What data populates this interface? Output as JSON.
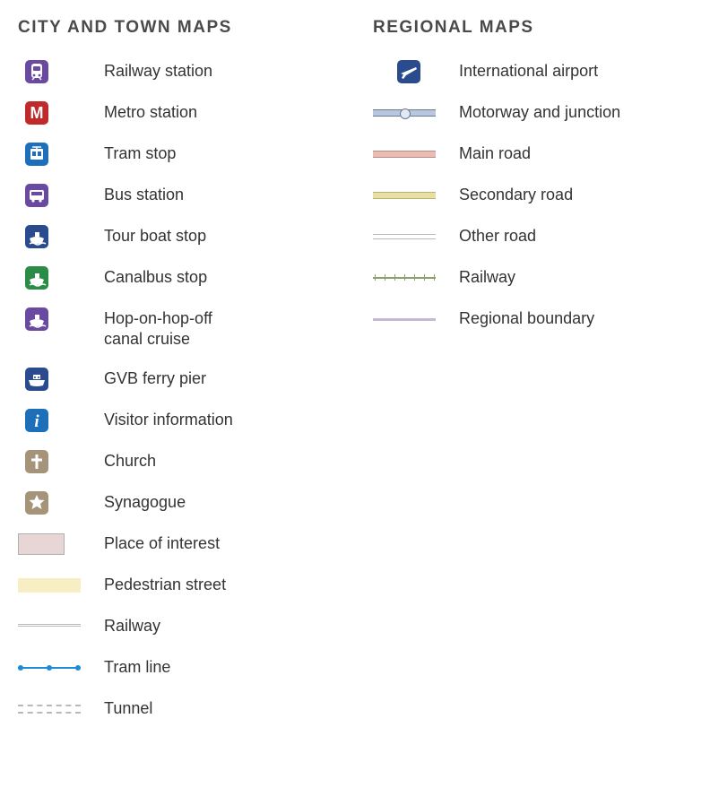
{
  "headings": {
    "city": "CITY AND TOWN MAPS",
    "regional": "REGIONAL MAPS"
  },
  "city_legend": [
    {
      "id": "railway-station",
      "label": "Railway station",
      "symbol": "icon",
      "icon": "train",
      "bg": "purple",
      "pos": "icon"
    },
    {
      "id": "metro-station",
      "label": "Metro station",
      "symbol": "icon",
      "icon": "metro",
      "bg": "red",
      "pos": "icon"
    },
    {
      "id": "tram-stop",
      "label": "Tram stop",
      "symbol": "icon",
      "icon": "tram",
      "bg": "blue",
      "pos": "icon"
    },
    {
      "id": "bus-station",
      "label": "Bus station",
      "symbol": "icon",
      "icon": "bus",
      "bg": "purple",
      "pos": "icon"
    },
    {
      "id": "tour-boat-stop",
      "label": "Tour boat stop",
      "symbol": "icon",
      "icon": "boat",
      "bg": "dblue",
      "pos": "icon"
    },
    {
      "id": "canalbus-stop",
      "label": "Canalbus stop",
      "symbol": "icon",
      "icon": "boat",
      "bg": "green",
      "pos": "icon"
    },
    {
      "id": "hop-on-hop-off",
      "label": "Hop-on-hop-off\ncanal cruise",
      "symbol": "icon",
      "icon": "boat",
      "bg": "purple",
      "pos": "icon"
    },
    {
      "id": "gvb-ferry-pier",
      "label": "GVB ferry pier",
      "symbol": "icon",
      "icon": "ferry",
      "bg": "dblue",
      "pos": "icon"
    },
    {
      "id": "visitor-info",
      "label": "Visitor information",
      "symbol": "icon",
      "icon": "info",
      "bg": "blue",
      "pos": "icon"
    },
    {
      "id": "church",
      "label": "Church",
      "symbol": "icon",
      "icon": "cross",
      "bg": "tan",
      "pos": "icon"
    },
    {
      "id": "synagogue",
      "label": "Synagogue",
      "symbol": "icon",
      "icon": "star",
      "bg": "tan",
      "pos": "icon"
    },
    {
      "id": "place-of-interest",
      "label": "Place of interest",
      "symbol": "block",
      "class": "place-interest",
      "pos": "full"
    },
    {
      "id": "pedestrian-street",
      "label": "Pedestrian street",
      "symbol": "block",
      "class": "ped-street",
      "pos": "full"
    },
    {
      "id": "railway-line",
      "label": "Railway",
      "symbol": "block",
      "class": "railway-city",
      "pos": "full"
    },
    {
      "id": "tram-line",
      "label": "Tram line",
      "symbol": "tram",
      "class": "tram-line",
      "pos": "full"
    },
    {
      "id": "tunnel",
      "label": "Tunnel",
      "symbol": "block",
      "class": "tunnel",
      "pos": "full"
    }
  ],
  "regional_legend": [
    {
      "id": "intl-airport",
      "label": "International airport",
      "symbol": "icon",
      "icon": "plane",
      "bg": "dblue",
      "pos": "center"
    },
    {
      "id": "motorway",
      "label": "Motorway and junction",
      "symbol": "block",
      "class": "motorway",
      "pos": "full"
    },
    {
      "id": "main-road",
      "label": "Main road",
      "symbol": "block",
      "class": "main-road",
      "pos": "full"
    },
    {
      "id": "secondary-road",
      "label": "Secondary road",
      "symbol": "block",
      "class": "sec-road",
      "pos": "full"
    },
    {
      "id": "other-road",
      "label": "Other road",
      "symbol": "block",
      "class": "other-road",
      "pos": "full"
    },
    {
      "id": "regional-railway",
      "label": "Railway",
      "symbol": "rail-ticks",
      "class": "railway-reg",
      "pos": "full"
    },
    {
      "id": "regional-boundary",
      "label": "Regional boundary",
      "symbol": "block",
      "class": "boundary",
      "pos": "full"
    }
  ]
}
